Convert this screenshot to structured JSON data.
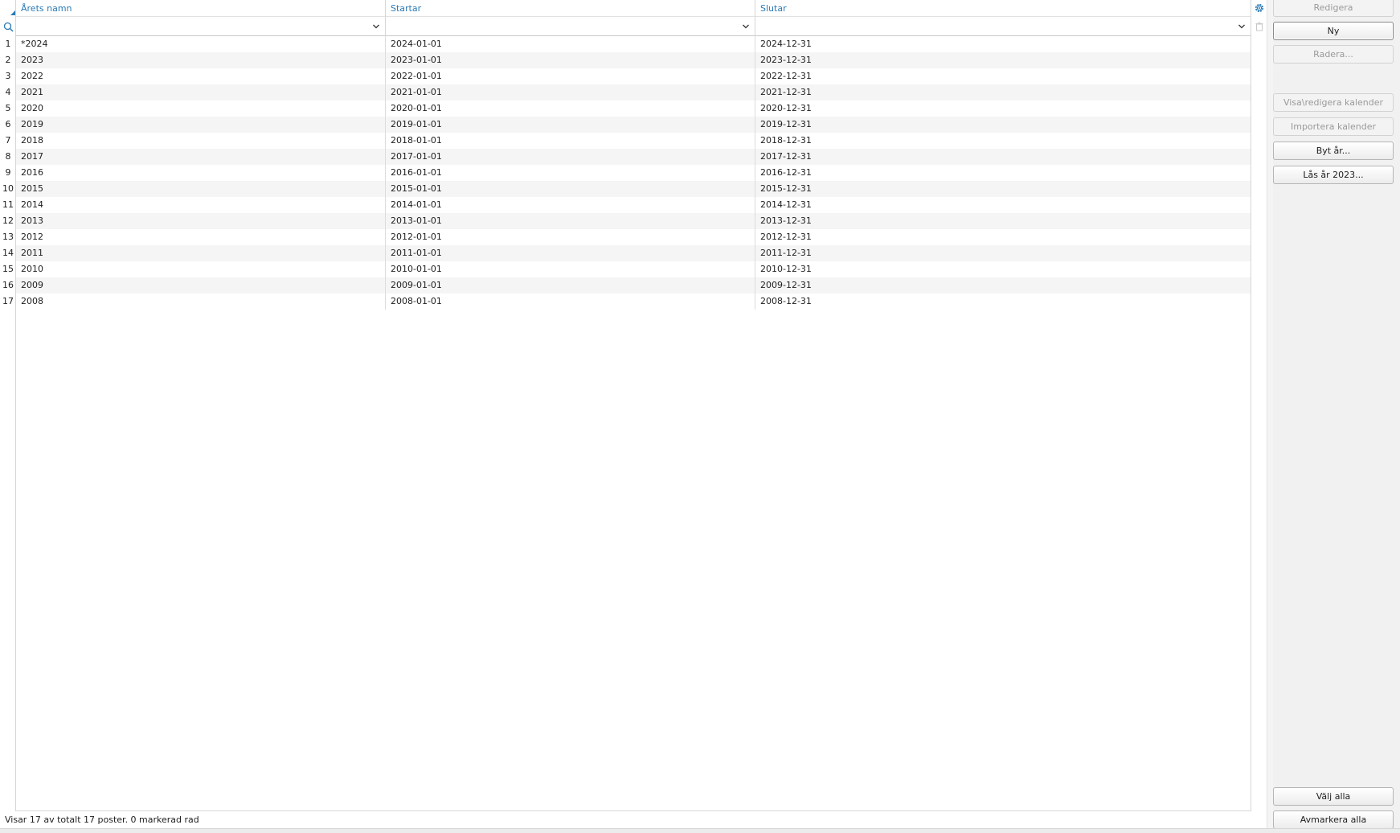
{
  "grid": {
    "columns": [
      {
        "label": "Årets namn"
      },
      {
        "label": "Startar"
      },
      {
        "label": "Slutar"
      }
    ],
    "rows": [
      {
        "num": "1",
        "name": "*2024",
        "start": "2024-01-01",
        "end": "2024-12-31"
      },
      {
        "num": "2",
        "name": "2023",
        "start": "2023-01-01",
        "end": "2023-12-31"
      },
      {
        "num": "3",
        "name": "2022",
        "start": "2022-01-01",
        "end": "2022-12-31"
      },
      {
        "num": "4",
        "name": "2021",
        "start": "2021-01-01",
        "end": "2021-12-31"
      },
      {
        "num": "5",
        "name": "2020",
        "start": "2020-01-01",
        "end": "2020-12-31"
      },
      {
        "num": "6",
        "name": "2019",
        "start": "2019-01-01",
        "end": "2019-12-31"
      },
      {
        "num": "7",
        "name": "2018",
        "start": "2018-01-01",
        "end": "2018-12-31"
      },
      {
        "num": "8",
        "name": "2017",
        "start": "2017-01-01",
        "end": "2017-12-31"
      },
      {
        "num": "9",
        "name": "2016",
        "start": "2016-01-01",
        "end": "2016-12-31"
      },
      {
        "num": "10",
        "name": "2015",
        "start": "2015-01-01",
        "end": "2015-12-31"
      },
      {
        "num": "11",
        "name": "2014",
        "start": "2014-01-01",
        "end": "2014-12-31"
      },
      {
        "num": "12",
        "name": "2013",
        "start": "2013-01-01",
        "end": "2013-12-31"
      },
      {
        "num": "13",
        "name": "2012",
        "start": "2012-01-01",
        "end": "2012-12-31"
      },
      {
        "num": "14",
        "name": "2011",
        "start": "2011-01-01",
        "end": "2011-12-31"
      },
      {
        "num": "15",
        "name": "2010",
        "start": "2010-01-01",
        "end": "2010-12-31"
      },
      {
        "num": "16",
        "name": "2009",
        "start": "2009-01-01",
        "end": "2009-12-31"
      },
      {
        "num": "17",
        "name": "2008",
        "start": "2008-01-01",
        "end": "2008-12-31"
      }
    ],
    "icons": {
      "sort_indicator": "sort-triangle-icon",
      "filter": "search-icon",
      "settings": "gear-icon",
      "delete": "trash-icon",
      "dropdown": "chevron-down-icon"
    }
  },
  "status": {
    "text": "Visar 17 av totalt 17 poster. 0 markerad rad"
  },
  "side_panel": {
    "redigera": "Redigera",
    "ny": "Ny",
    "radera": "Radera...",
    "visa_redigera_kalender": "Visa\\redigera kalender",
    "importera_kalender": "Importera kalender",
    "byt_ar": "Byt år...",
    "las_ar": "Lås år 2023...",
    "valj_alla": "Välj alla",
    "avmarkera_alla": "Avmarkera alla"
  },
  "colors": {
    "accent": "#2a7ab5",
    "row_alt": "#f5f5f5",
    "panel_bg": "#f1f1f1",
    "disabled_text": "#9a9a9a"
  }
}
